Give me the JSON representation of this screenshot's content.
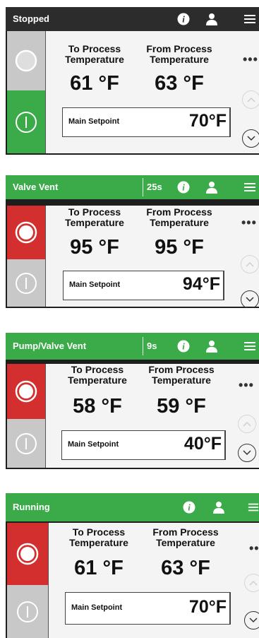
{
  "colors": {
    "dark": "#2c2c2c",
    "green": "#3aab48",
    "red": "#d32f2f",
    "gray": "#c8c8c8"
  },
  "panels": [
    {
      "status": "Stopped",
      "timer": "",
      "to_label": "To Process\nTemperature",
      "from_label": "From Process\nTemperature",
      "to_temp": "61 °F",
      "from_temp": "63 °F",
      "setpoint_label": "Main Setpoint",
      "setpoint_value": "70°F",
      "more": "•••"
    },
    {
      "status": "Valve Vent",
      "timer": "25s",
      "to_label": "To Process\nTemperature",
      "from_label": "From Process\nTemperature",
      "to_temp": "95 °F",
      "from_temp": "95 °F",
      "setpoint_label": "Main Setpoint",
      "setpoint_value": "94°F",
      "more": "•••"
    },
    {
      "status": "Pump/Valve Vent",
      "timer": "9s",
      "to_label": "To Process\nTemperature",
      "from_label": "From Process\nTemperature",
      "to_temp": "58 °F",
      "from_temp": "59 °F",
      "setpoint_label": "Main Setpoint",
      "setpoint_value": "40°F",
      "more": "•••"
    },
    {
      "status": "Running",
      "timer": "",
      "to_label": "To Process\nTemperature",
      "from_label": "From Process\nTemperature",
      "to_temp": "61 °F",
      "from_temp": "63 °F",
      "setpoint_label": "Main Setpoint",
      "setpoint_value": "70°F",
      "more": "••"
    }
  ]
}
